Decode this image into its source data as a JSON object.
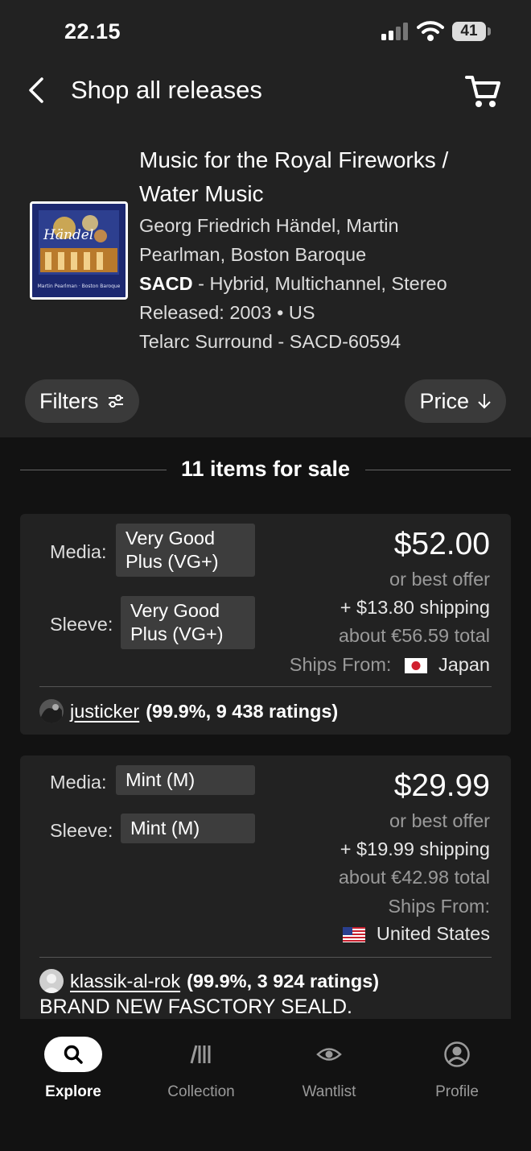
{
  "status_bar": {
    "time": "22.15",
    "battery": "41"
  },
  "header": {
    "title": "Shop all releases"
  },
  "release": {
    "title_line1": "Music for the Royal Fireworks /",
    "title_line2": "Water Music",
    "artists_line1": "Georg Friedrich Händel, Martin",
    "artists_line2": "Pearlman, Boston Baroque",
    "format_bold": "SACD",
    "format_rest": " - Hybrid, Multichannel, Stereo",
    "released": "Released: 2003 • US",
    "label": "Telarc Surround - SACD-60594",
    "cover_text": "Händel",
    "cover_subtext": "Martin Pearlman · Boston Baroque"
  },
  "controls": {
    "filters_label": "Filters",
    "sort_label": "Price"
  },
  "listing_summary": {
    "count_text": "11 items for sale"
  },
  "listings": [
    {
      "media_label": "Media:",
      "media_grade_line1": "Very Good",
      "media_grade_line2": "Plus (VG+)",
      "sleeve_label": "Sleeve:",
      "sleeve_grade_line1": "Very Good",
      "sleeve_grade_line2": "Plus (VG+)",
      "price": "$52.00",
      "offer": "or best offer",
      "shipping": "+ $13.80 shipping",
      "total": "about €56.59 total",
      "ships_from_label": "Ships From:",
      "ships_from_country": "Japan",
      "seller_name": "justicker",
      "seller_rating": "(99.9%, 9 438 ratings)"
    },
    {
      "media_label": "Media:",
      "media_grade": "Mint (M)",
      "sleeve_label": "Sleeve:",
      "sleeve_grade": "Mint (M)",
      "price": "$29.99",
      "offer": "or best offer",
      "shipping": "+ $19.99 shipping",
      "total": "about €42.98 total",
      "ships_from_label": "Ships From:",
      "ships_from_country": "United States",
      "seller_name": "klassik-al-rok",
      "seller_rating": "(99.9%, 3 924 ratings)",
      "comment": "BRAND NEW FASCTORY SEALD."
    }
  ],
  "bottom_nav": [
    {
      "label": "Explore",
      "icon": "search-icon",
      "active": true
    },
    {
      "label": "Collection",
      "icon": "collection-icon",
      "active": false
    },
    {
      "label": "Wantlist",
      "icon": "eye-icon",
      "active": false
    },
    {
      "label": "Profile",
      "icon": "profile-icon",
      "active": false
    }
  ],
  "colors": {
    "background": "#121212",
    "panel": "#222222",
    "grade_chip": "#3d3d3d",
    "muted_text": "#9a9a9a"
  }
}
